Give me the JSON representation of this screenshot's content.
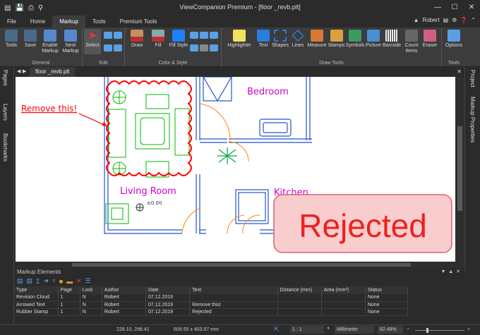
{
  "window": {
    "title": "ViewCompanion Premium - [floor _revb.plt]"
  },
  "ribbon_tabs": [
    "File",
    "Home",
    "Markup",
    "Tools",
    "Premium Tools"
  ],
  "user": {
    "name": "Robert"
  },
  "ribbon": {
    "groups": {
      "general": "General",
      "edit": "Edit",
      "color_style": "Color & Style",
      "draw_tools": "Draw Tools",
      "tools": "Tools"
    },
    "buttons": {
      "tools": "Tools",
      "save": "Save",
      "enable_markup": "Enable Markup",
      "next_markup": "Next Markup",
      "select": "Select",
      "draw": "Draw",
      "fill": "Fill",
      "fill_style": "Fill Style",
      "highlighter": "Highlighter",
      "text": "Text",
      "shapes": "Shapes",
      "lines": "Lines",
      "measure": "Measure",
      "stamps": "Stamps",
      "symbols": "Symbols",
      "picture": "Picture",
      "barcode": "Barcode",
      "count_items": "Count Items",
      "eraser": "Eraser",
      "options": "Options"
    }
  },
  "side_panels": {
    "left": [
      "Pages",
      "Layers",
      "Bookmarks"
    ],
    "right": [
      "Project",
      "Markup Properties"
    ]
  },
  "document_tab": "floor _revb.plt",
  "drawing": {
    "rooms": {
      "bedroom": "Bedroom",
      "living": "Living  Room",
      "kitchen": "Kitchen"
    },
    "annotation": "Remove this!",
    "stamp": "Rejected",
    "coord_label": "±0.00"
  },
  "markup_elements": {
    "title": "Markup Elements",
    "columns": [
      "Type",
      "Page",
      "Lock",
      "Author",
      "Date",
      "Text",
      "Distance (mm)",
      "Area (mm²)",
      "Status"
    ],
    "rows": [
      [
        "Revision Cloud",
        "1",
        "N",
        "Robert",
        "07.12.2019",
        "",
        "",
        "",
        "None"
      ],
      [
        "Arrowed Text",
        "1",
        "N",
        "Robert",
        "07.12.2019",
        "Remove this!",
        "",
        "",
        "None"
      ],
      [
        "Rubber Stamp",
        "1",
        "N",
        "Robert",
        "07.12.2019",
        "Rejected",
        "",
        "",
        "None"
      ]
    ]
  },
  "status": {
    "coords": "228.10, 296.41",
    "size": "609.55 x 403.97 mm",
    "scale": "1 : 1",
    "units": "Millimeter",
    "zoom": "62.48%"
  },
  "colors": {
    "background": "#2b2b2b",
    "ribbon": "#3c3c3c",
    "plan_blue": "#2255cc",
    "plan_green": "#00bb00",
    "markup_red": "#ff0000",
    "room_magenta": "#cc00cc",
    "stamp_fill": "#f8c8c8"
  }
}
